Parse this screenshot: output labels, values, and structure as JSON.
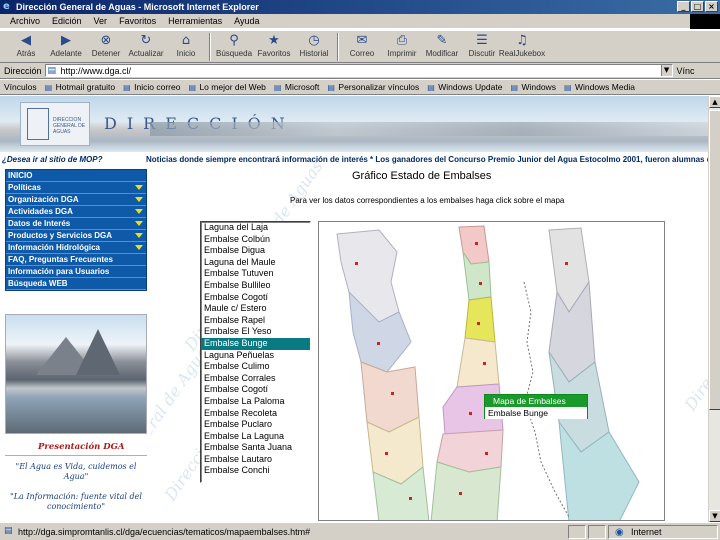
{
  "window": {
    "title": "Dirección General de Aguas - Microsoft Internet Explorer",
    "buttons": [
      "minimize",
      "maximize",
      "close"
    ]
  },
  "menu": [
    "Archivo",
    "Edición",
    "Ver",
    "Favoritos",
    "Herramientas",
    "Ayuda"
  ],
  "toolbar": [
    {
      "label": "Atrás",
      "icon": "back-arrow-icon"
    },
    {
      "label": "Adelante",
      "icon": "forward-arrow-icon"
    },
    {
      "label": "Detener",
      "icon": "stop-icon"
    },
    {
      "label": "Actualizar",
      "icon": "refresh-icon"
    },
    {
      "label": "Inicio",
      "icon": "home-icon"
    },
    {
      "label": "Búsqueda",
      "icon": "search-icon"
    },
    {
      "label": "Favoritos",
      "icon": "favorites-icon"
    },
    {
      "label": "Historial",
      "icon": "history-icon"
    },
    {
      "label": "Correo",
      "icon": "mail-icon"
    },
    {
      "label": "Imprimir",
      "icon": "print-icon"
    },
    {
      "label": "Modificar",
      "icon": "edit-icon"
    },
    {
      "label": "Discutir",
      "icon": "discuss-icon"
    },
    {
      "label": "RealJukebox",
      "icon": "realjukebox-icon"
    }
  ],
  "address": {
    "label": "Dirección",
    "url": "http://www.dga.cl/",
    "right_label": "Vínc"
  },
  "links": {
    "label": "Vínculos",
    "items": [
      "Hotmail gratuito",
      "Inicio correo",
      "Lo mejor del Web",
      "Microsoft",
      "Personalizar vínculos",
      "Windows Update",
      "Windows",
      "Windows Media"
    ]
  },
  "banner": {
    "logo_text": "DIRECCION GENERAL DE AGUAS",
    "brand": "DIRECCIÓN"
  },
  "ticker": {
    "left": "¿Desea ir al sitio de MOP?",
    "right": "Noticias donde siempre encontrará información de interés  *  Los ganadores del Concurso Premio Junior del Agua Estocolmo 2001, fueron alumnas de la ciu"
  },
  "nav": [
    {
      "label": "INICIO",
      "arrow": false
    },
    {
      "label": "Políticas",
      "arrow": true
    },
    {
      "label": "Organización DGA",
      "arrow": true
    },
    {
      "label": "Actividades DGA",
      "arrow": true
    },
    {
      "label": "Datos de Interés",
      "arrow": true
    },
    {
      "label": "Productos y Servicios DGA",
      "arrow": true
    },
    {
      "label": "Información Hidrológica",
      "arrow": true
    },
    {
      "label": "FAQ, Preguntas Frecuentes",
      "arrow": false
    },
    {
      "label": "Información para Usuarios",
      "arrow": false
    },
    {
      "label": "Búsqueda WEB",
      "arrow": false
    }
  ],
  "presentation_link": "Presentación DGA",
  "quotes": [
    "\"El Agua es Vida, cuidemos el Agua\"",
    "\"La Información: fuente vital del conocimiento\""
  ],
  "watermark": "Dirección General de Aguas",
  "main": {
    "heading": "Gráfico Estado de Embalses",
    "subtitle": "Para ver los datos correspondientes a los embalses haga click sobre el mapa"
  },
  "reservoirs": {
    "items": [
      "Laguna del Laja",
      "Embalse Colbún",
      "Embalse Digua",
      "Laguna del Maule",
      "Embalse Tutuven",
      "Embalse Bullileo",
      "Embalse Cogotí",
      "Maule c/ Estero",
      "Embalse Rapel",
      "Embalse El Yeso",
      "Embalse Bunge",
      "Laguna Peñuelas",
      "Embalse Culimo",
      "Embalse Corrales",
      "Embalse Cogotí",
      "Embalse La Paloma",
      "Embalse Recoleta",
      "Embalse Puclaro",
      "Embalse La Laguna",
      "Embalse Santa Juana",
      "Embalse Lautaro",
      "Embalse Conchi"
    ],
    "selected_index": 10
  },
  "map_popup": {
    "header": "Mapa de Embalses",
    "value": "Embalse Bunge"
  },
  "status": {
    "url": "http://dga.simpromtanlis.cl/dga/ecuencias/tematicos/mapaembalses.htm#",
    "zone": "Internet"
  },
  "colors": {
    "title_bar": "#0a246a",
    "nav_bg": "#0f5aa8",
    "nav_arrow": "#e8e020",
    "selection": "#0a7a82",
    "popup_header": "#1a9a2a",
    "quote_text": "#1a3f85",
    "presentation": "#b01818"
  }
}
